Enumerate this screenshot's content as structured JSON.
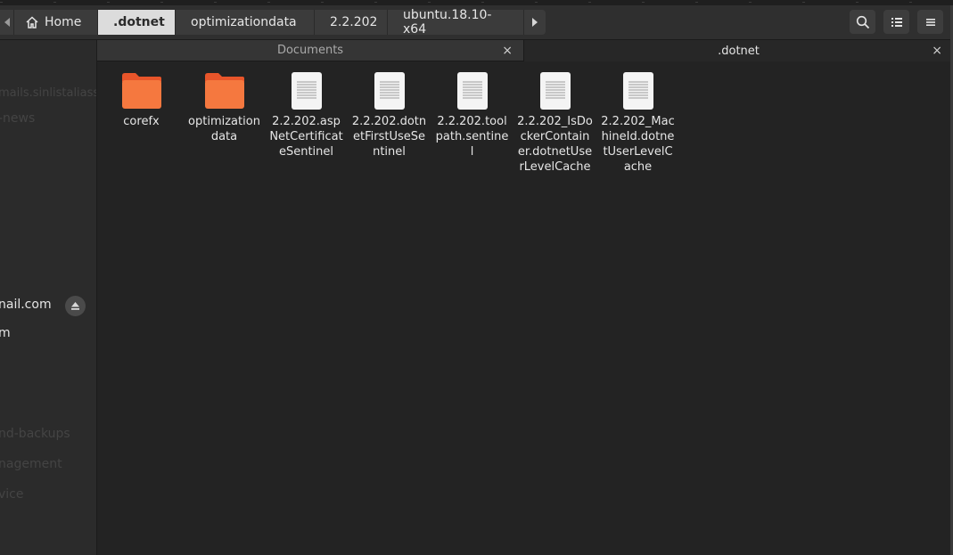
{
  "pathbar": {
    "crumbs": [
      "Home",
      ".dotnet",
      "optimizationdata",
      "2.2.202",
      "ubuntu.18.10-x64"
    ]
  },
  "header_buttons": [
    "search-icon",
    "list-view-icon",
    "menu-icon"
  ],
  "sidebar": {
    "items": [
      {
        "label": "mails.sinlistaliass"
      },
      {
        "label": "-news"
      },
      {
        "label": "nail.com"
      },
      {
        "label": "m"
      },
      {
        "label": "nd-backups"
      },
      {
        "label": "nagement"
      },
      {
        "label": "vice"
      }
    ]
  },
  "tabs": [
    {
      "label": "Documents",
      "close": "×"
    },
    {
      "label": ".dotnet",
      "close": "×"
    }
  ],
  "files": [
    {
      "name": "corefx",
      "type": "folder"
    },
    {
      "name": "optimizationdata",
      "type": "folder"
    },
    {
      "name": "2.2.202.aspNetCertificateSentinel",
      "type": "file"
    },
    {
      "name": "2.2.202.dotnetFirstUseSentinel",
      "type": "file"
    },
    {
      "name": "2.2.202.toolpath.sentinel",
      "type": "file"
    },
    {
      "name": "2.2.202_IsDockerContainer.dotnetUserLevelCache",
      "type": "file"
    },
    {
      "name": "2.2.202_MachineId.dotnetUserLevelCache",
      "type": "file"
    }
  ],
  "colors": {
    "folder": "#f5783f",
    "folder_tab": "#e8552a",
    "active_crumb": "#dcdcdc",
    "content_bg": "#232323"
  }
}
